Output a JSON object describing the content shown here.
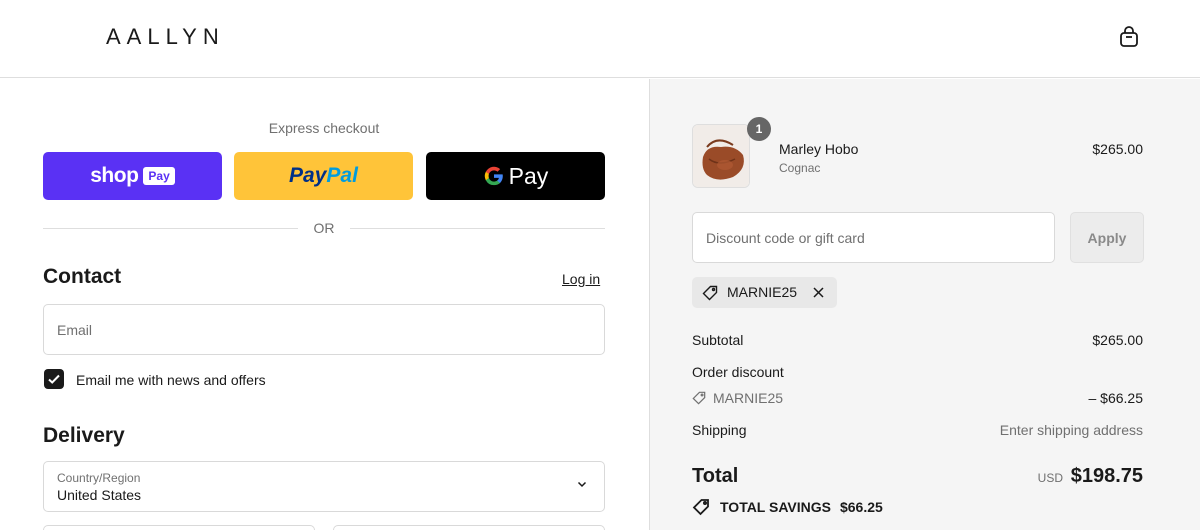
{
  "brand": {
    "logo_text": "AALLYN"
  },
  "header": {
    "cart_icon": "shopping-bag-icon"
  },
  "express": {
    "title": "Express checkout",
    "shop_pay": {
      "word": "shop",
      "badge": "Pay"
    },
    "paypal": {
      "part1": "Pay",
      "part2": "Pal"
    },
    "google_pay": {
      "g": "G",
      "word": "Pay"
    },
    "or_text": "OR"
  },
  "contact": {
    "title": "Contact",
    "login_label": "Log in",
    "email_placeholder": "Email",
    "newsletter_label": "Email me with news and offers",
    "newsletter_checked": true
  },
  "delivery": {
    "title": "Delivery",
    "country_label": "Country/Region",
    "country_value": "United States"
  },
  "order": {
    "item": {
      "quantity": "1",
      "name": "Marley Hobo",
      "variant": "Cognac",
      "price": "$265.00"
    },
    "discount_placeholder": "Discount code or gift card",
    "apply_label": "Apply",
    "applied_code": "MARNIE25",
    "subtotal_label": "Subtotal",
    "subtotal_value": "$265.00",
    "order_discount_label": "Order discount",
    "discount_code": "MARNIE25",
    "discount_value": "– $66.25",
    "shipping_label": "Shipping",
    "shipping_value": "Enter shipping address",
    "total_label": "Total",
    "currency": "USD",
    "total_value": "$198.75",
    "savings_label": "TOTAL SAVINGS",
    "savings_value": "$66.25"
  },
  "colors": {
    "shop_pay": "#5a31f4",
    "paypal": "#ffc439",
    "paypal_dark": "#003087",
    "paypal_light": "#009cde",
    "google_pay": "#000000",
    "sidebar_bg": "#f5f5f5"
  }
}
